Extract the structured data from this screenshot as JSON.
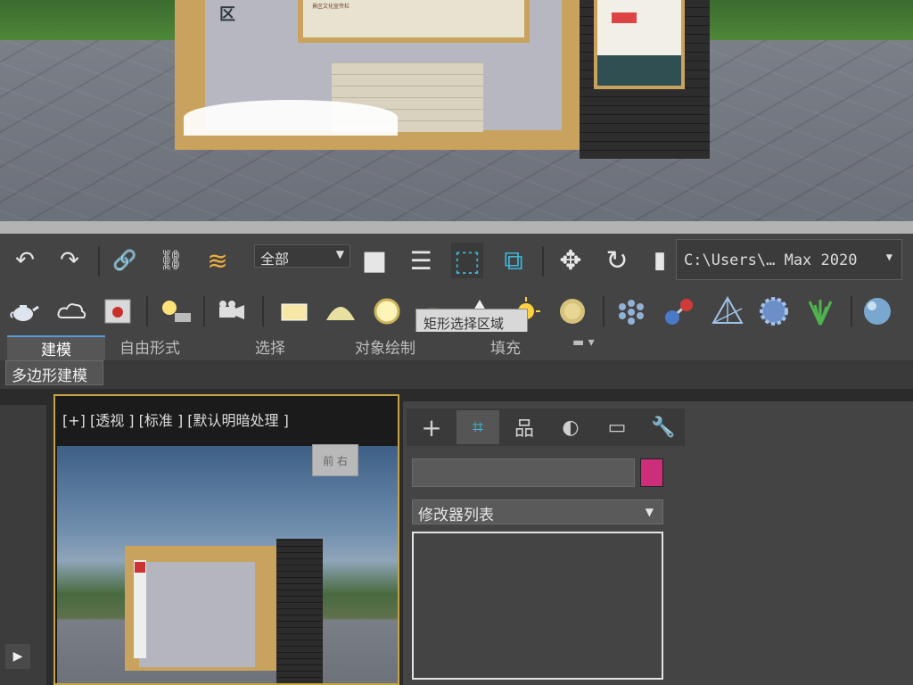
{
  "scene": {
    "sign_char": "区",
    "board_text": "景区文化宣传栏",
    "colors": {
      "gold": "#c9a35e",
      "panel": "#b7b7c2",
      "wall": "#2d2d2d"
    }
  },
  "toolbar": {
    "undo_icon": "↶",
    "redo_icon": "↷",
    "link_icon": "🔗",
    "unlink_icon": "⛓",
    "bind_icon": "≋",
    "selection_filter": "全部",
    "select_icon": "■",
    "select_by_name_icon": "☰",
    "rect_region_icon": "⬚",
    "window_crossing_icon": "⧉",
    "move_icon": "✥",
    "rotate_icon": "↻",
    "scale_icon": "▮",
    "path": "C:\\Users\\… Max 2020"
  },
  "row2_icons": [
    "teapot-icon",
    "cloud-icon",
    "render-frame-icon",
    "light-icon",
    "camera-icon",
    "plane-light-icon",
    "dome-icon",
    "sphere-light-icon",
    "lamp-icon",
    "cone-icon",
    "sun-icon",
    "disc-light-icon",
    "grid-icon",
    "molecule-icon",
    "pyramid-icon",
    "gear-sphere-icon",
    "plant-icon",
    "sphere-icon"
  ],
  "tooltip": "矩形选择区域",
  "ribbon": {
    "tabs": [
      {
        "label": "建模",
        "active": true
      },
      {
        "label": "自由形式",
        "active": false
      },
      {
        "label": "选择",
        "active": false
      },
      {
        "label": "对象绘制",
        "active": false
      },
      {
        "label": "填充",
        "active": false
      }
    ],
    "sub_button": "多边形建模"
  },
  "viewport": {
    "label": "[+] [透视 ] [标准 ] [默认明暗处理 ]",
    "viewcube_front": "前",
    "viewcube_right": "右"
  },
  "command_panel": {
    "tabs": [
      "+",
      "⌗",
      "品",
      "◐",
      "▭",
      "🔧"
    ],
    "modifier_list": "修改器列表",
    "color_swatch": "#cc2e7a"
  },
  "play_icon": "▶"
}
